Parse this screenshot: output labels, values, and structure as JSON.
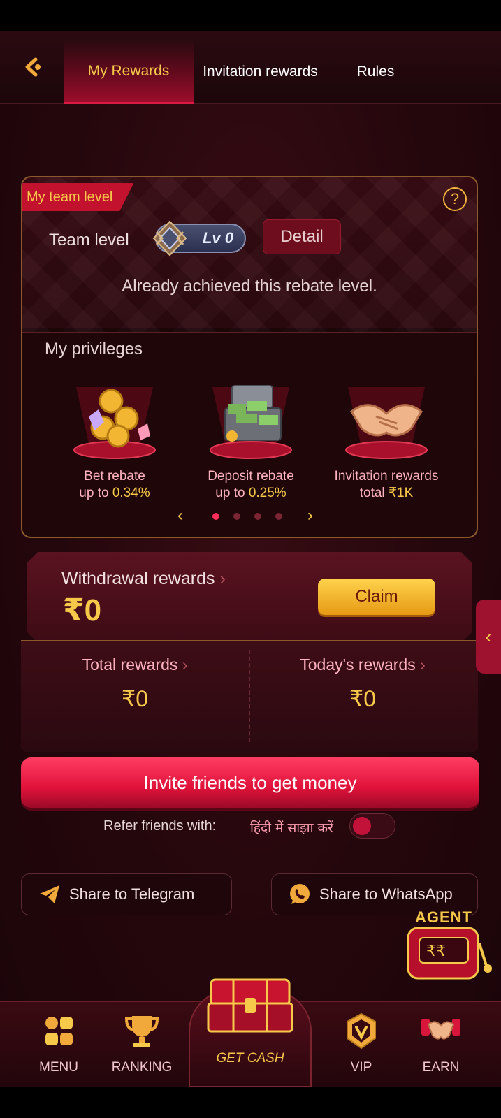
{
  "header": {
    "tabs": [
      {
        "label": "My Rewards",
        "active": true
      },
      {
        "label": "Invitation rewards",
        "active": false
      },
      {
        "label": "Rules",
        "active": false
      }
    ]
  },
  "team": {
    "ribbon": "My team level",
    "level_label": "Team level",
    "level_badge": "Lv 0",
    "detail_button": "Detail",
    "status": "Already achieved this rebate level.",
    "privileges_title": "My privileges",
    "privileges": [
      {
        "line1": "Bet rebate",
        "line2_prefix": "up to ",
        "line2_value": "0.34%"
      },
      {
        "line1": "Deposit rebate",
        "line2_prefix": "up to ",
        "line2_value": "0.25%"
      },
      {
        "line1": "Invitation rewards",
        "line2_prefix": "total ",
        "line2_value": "₹1K"
      }
    ],
    "pager": {
      "pages": 4,
      "current": 1
    }
  },
  "withdrawal": {
    "label": "Withdrawal rewards",
    "amount": "₹0",
    "claim_button": "Claim"
  },
  "rewards": {
    "total_label": "Total rewards",
    "total_value": "₹0",
    "today_label": "Today's rewards",
    "today_value": "₹0"
  },
  "invite_button": "Invite friends to get money",
  "refer": {
    "label": "Refer friends with:",
    "language_option": "हिंदी में साझा करें",
    "toggle_on": false
  },
  "share": {
    "telegram": "Share to Telegram",
    "whatsapp": "Share to WhatsApp"
  },
  "agent": {
    "label": "AGENT"
  },
  "nav": {
    "menu": "MENU",
    "ranking": "RANKING",
    "get_cash": "GET CASH",
    "vip": "VIP",
    "earn": "EARN"
  },
  "colors": {
    "accent_gold": "#f7c94a",
    "accent_red": "#e0123a",
    "background": "#24070c"
  }
}
